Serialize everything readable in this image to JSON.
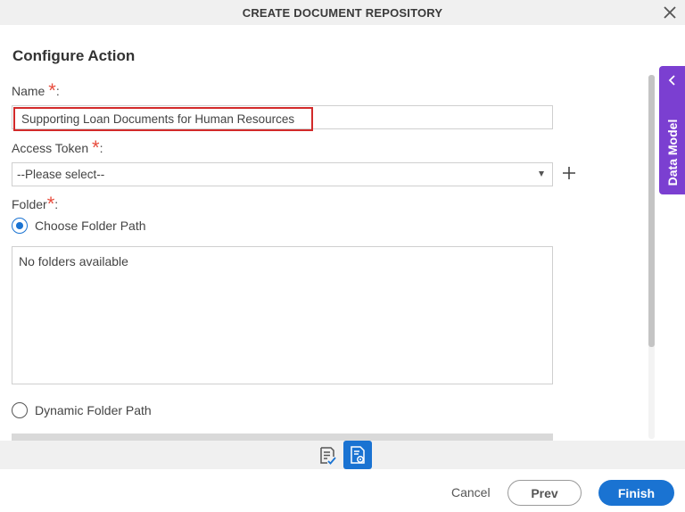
{
  "dialog": {
    "title": "CREATE DOCUMENT REPOSITORY",
    "close_icon": "close-icon"
  },
  "section": {
    "title": "Configure Action"
  },
  "fields": {
    "name": {
      "label": "Name",
      "required_mark": "*",
      "suffix": ":",
      "value": "Supporting Loan Documents for Human Resources"
    },
    "access_token": {
      "label": "Access Token",
      "required_mark": "*",
      "suffix": ":",
      "selected": "--Please select--",
      "add_icon": "plus-icon"
    },
    "folder": {
      "label": "Folder",
      "required_mark": "*",
      "suffix": ":",
      "options": [
        {
          "label": "Choose Folder Path",
          "checked": true
        },
        {
          "label": "Dynamic Folder Path",
          "checked": false
        }
      ],
      "empty_text": "No folders available"
    }
  },
  "side_panel": {
    "label": "Data Model",
    "icon": "chevron-left-icon",
    "color": "#7b3fd1"
  },
  "footer": {
    "icons": [
      "validate-icon",
      "settings-document-icon"
    ],
    "cancel_label": "Cancel",
    "prev_label": "Prev",
    "finish_label": "Finish",
    "accent_color": "#1a73d2"
  }
}
